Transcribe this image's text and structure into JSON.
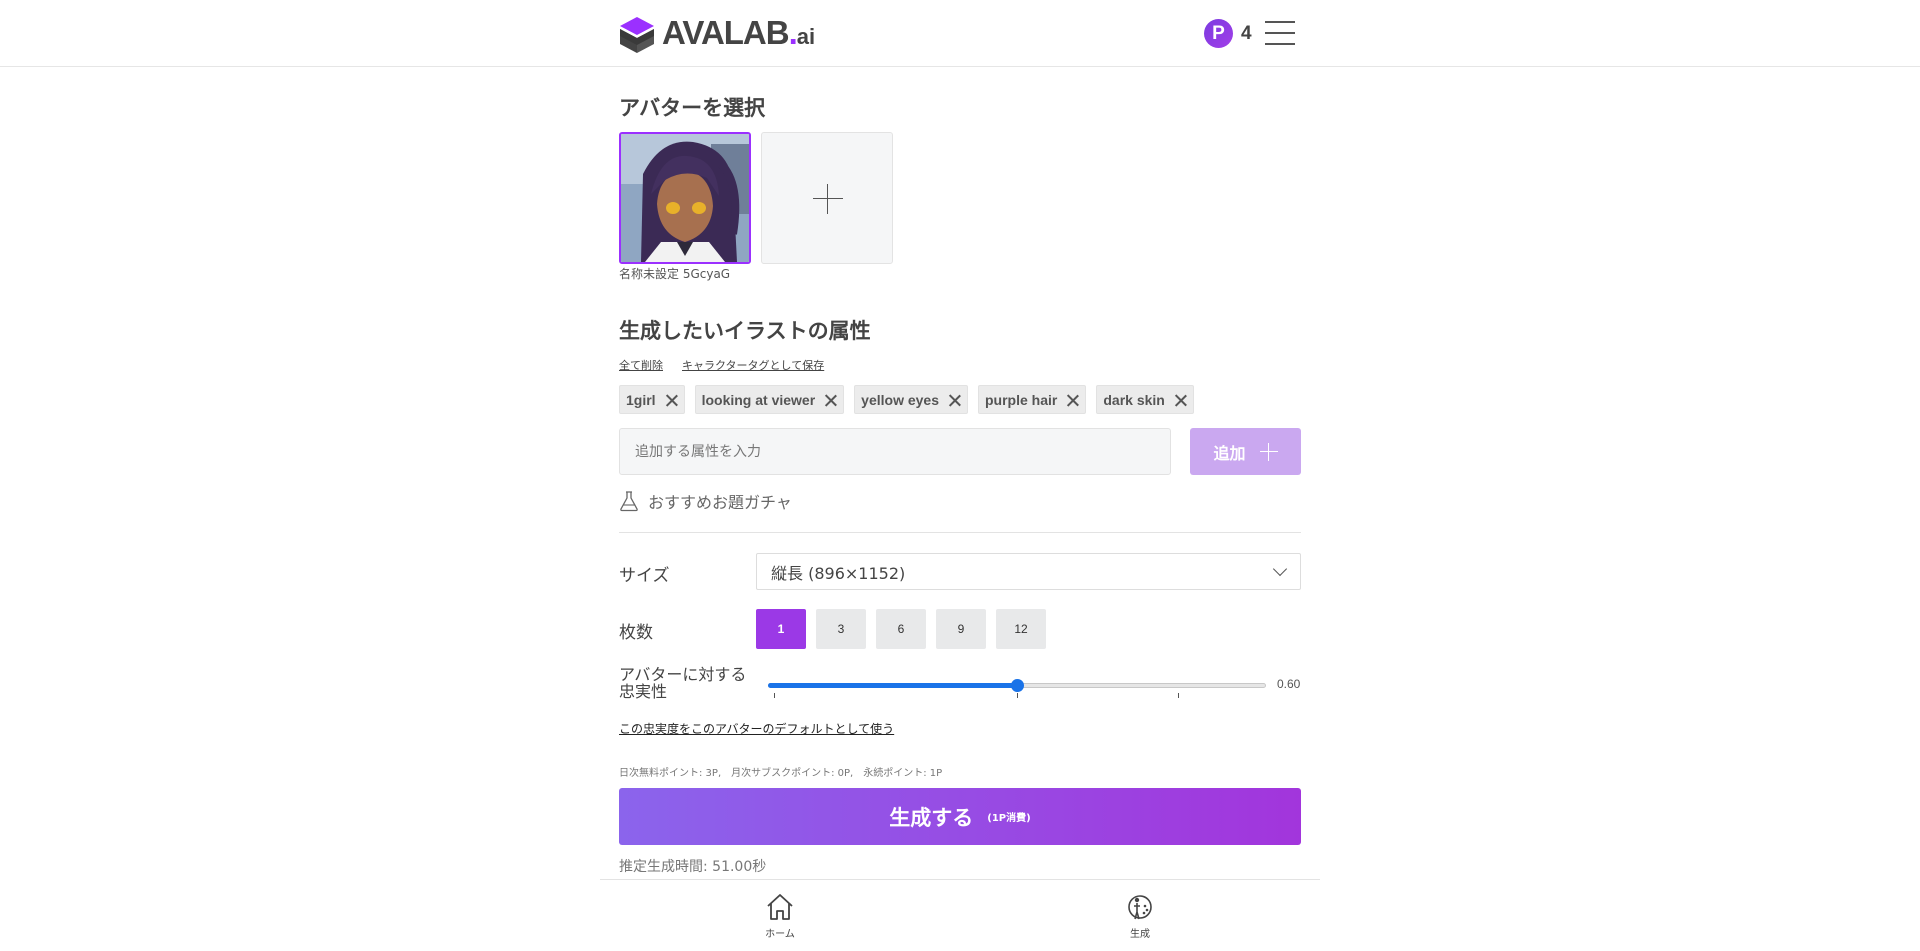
{
  "header": {
    "logo_text": "AVALAB",
    "logo_dot": ".",
    "logo_suffix": "ai",
    "points_badge": "P",
    "points_count": "4"
  },
  "avatar_section": {
    "title": "アバターを選択",
    "selected_avatar_name": "名称未設定 5GcyaG"
  },
  "attributes_section": {
    "title": "生成したいイラストの属性",
    "clear_all": "全て削除",
    "save_as_tag": "キャラクタータグとして保存",
    "tags": [
      "1girl",
      "looking at viewer",
      "yellow eyes",
      "purple hair",
      "dark skin"
    ],
    "input_placeholder": "追加する属性を入力",
    "add_button": "追加",
    "gacha_label": "おすすめお題ガチャ"
  },
  "settings": {
    "size_label": "サイズ",
    "size_value": "縦長 (896×1152)",
    "count_label": "枚数",
    "count_options": [
      "1",
      "3",
      "6",
      "9",
      "12"
    ],
    "count_selected": "1",
    "fidelity_label": "アバターに対する忠実性",
    "fidelity_value": "0.60",
    "fidelity_level": 0.5,
    "fidelity_default_link": "この忠実度をこのアバターのデフォルトとして使う"
  },
  "generate": {
    "points_info": "日次無料ポイント: 3P,　月次サブスクポイント: 0P,　永続ポイント: 1P",
    "button_label": "生成する",
    "button_cost": "(1P消費)",
    "estimated_time": "推定生成時間: 51.00秒"
  },
  "bottom_nav": {
    "home_label": "ホーム",
    "generate_label": "生成"
  },
  "colors": {
    "accent": "#9b39e6",
    "slider": "#1a73e8"
  }
}
